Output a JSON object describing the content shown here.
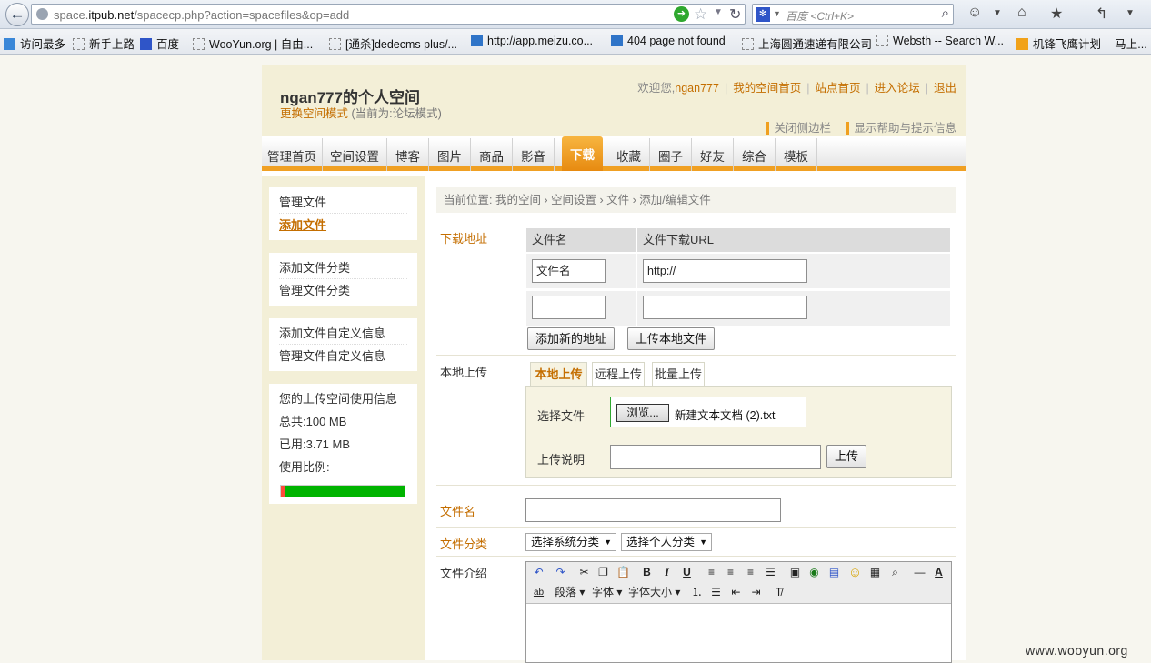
{
  "browser": {
    "url_prefix": "space.",
    "url_domain": "itpub.net",
    "url_path": "/spacecp.php?action=spacefiles&op=add",
    "search_placeholder": "百度 <Ctrl+K>",
    "bookmarks": [
      "访问最多",
      "新手上路",
      "百度",
      "WooYun.org | 自由...",
      "[通杀]dedecms plus/...",
      "http://app.meizu.co...",
      "404 page not found",
      "上海圆通速递有限公司",
      "Websth -- Search W...",
      "机锋飞鹰计划 -- 马上..."
    ]
  },
  "header": {
    "site_title": "ngan777的个人空间",
    "switch_mode": "更换空间模式",
    "current_mode": "(当前为:论坛模式)",
    "welcome": "欢迎您,",
    "username": "ngan777",
    "links": [
      "我的空间首页",
      "站点首页",
      "进入论坛",
      "退出"
    ],
    "options": [
      "关闭侧边栏",
      "显示帮助与提示信息"
    ]
  },
  "nav_tabs": [
    "管理首页",
    "空间设置",
    "博客",
    "图片",
    "商品",
    "影音",
    "下载",
    "收藏",
    "圈子",
    "好友",
    "综合",
    "模板"
  ],
  "sidebar": {
    "group1": [
      "管理文件",
      "添加文件"
    ],
    "group2": [
      "添加文件分类",
      "管理文件分类"
    ],
    "group3": [
      "添加文件自定义信息",
      "管理文件自定义信息"
    ],
    "usage_title": "您的上传空间使用信息",
    "usage_total": "总共:100 MB",
    "usage_used": "已用:3.71 MB",
    "usage_ratio_label": "使用比例:",
    "usage_ratio": 0.037
  },
  "breadcrumb": "当前位置: 我的空间 › 空间设置 › 文件 › 添加/编辑文件",
  "download": {
    "label": "下载地址",
    "col_name": "文件名",
    "col_url": "文件下载URL",
    "row1_name": "文件名",
    "row1_url": "http://",
    "add_btn": "添加新的地址",
    "upload_local_btn": "上传本地文件"
  },
  "local_upload": {
    "label": "本地上传",
    "tabs": [
      "本地上传",
      "远程上传",
      "批量上传"
    ],
    "choose_label": "选择文件",
    "browse_btn": "浏览...",
    "file_name": "新建文本文档 (2).txt",
    "desc_label": "上传说明",
    "upload_btn": "上传"
  },
  "file_name_label": "文件名",
  "category": {
    "label": "文件分类",
    "system": "选择系统分类",
    "personal": "选择个人分类"
  },
  "intro": {
    "label": "文件介绍",
    "dropdowns": [
      "段落",
      "字体",
      "字体大小"
    ]
  },
  "watermark": "www.wooyun.org"
}
